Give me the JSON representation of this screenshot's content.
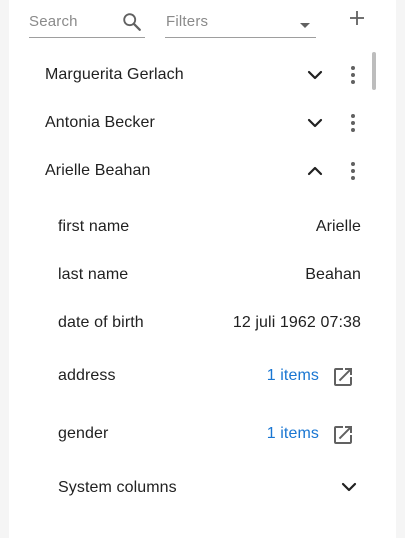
{
  "toolbar": {
    "search_placeholder": "Search",
    "filters_placeholder": "Filters"
  },
  "records": [
    {
      "name": "Marguerita Gerlach",
      "expanded": false
    },
    {
      "name": "Antonia Becker",
      "expanded": false
    },
    {
      "name": "Arielle Beahan",
      "expanded": true
    }
  ],
  "detail": {
    "first_name": {
      "label": "first name",
      "value": "Arielle"
    },
    "last_name": {
      "label": "last name",
      "value": "Beahan"
    },
    "date_of_birth": {
      "label": "date of birth",
      "value": "12 juli 1962 07:38"
    },
    "address": {
      "label": "address",
      "value": "1 items"
    },
    "gender": {
      "label": "gender",
      "value": "1 items"
    },
    "system_columns": {
      "label": "System columns"
    }
  },
  "colors": {
    "link": "#1976d2",
    "text": "#212121",
    "placeholder": "#8a8a8a"
  }
}
